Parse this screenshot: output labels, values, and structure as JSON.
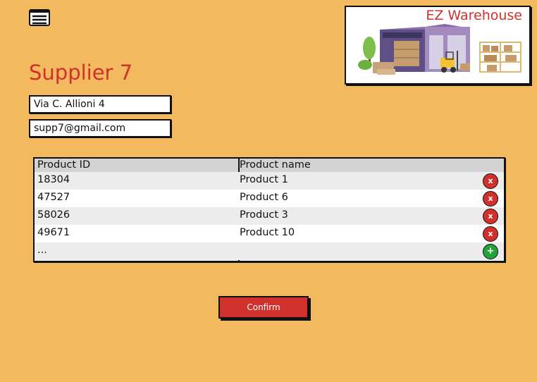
{
  "header": {
    "menu_icon": "hamburger-menu-icon",
    "brand_title": "EZ Warehouse"
  },
  "supplier": {
    "title": "Supplier 7",
    "address": "Via C. Allioni 4",
    "email": "supp7@gmail.com"
  },
  "table": {
    "columns": [
      "Product ID",
      "Product name"
    ],
    "rows": [
      {
        "id": "18304",
        "name": "Product 1",
        "action": "x"
      },
      {
        "id": "47527",
        "name": "Product 6",
        "action": "x"
      },
      {
        "id": "58026",
        "name": "Product 3",
        "action": "x"
      },
      {
        "id": "49671",
        "name": "Product 10",
        "action": "x"
      }
    ],
    "more_row": {
      "id": "...",
      "action": "+"
    }
  },
  "actions": {
    "confirm_label": "Confirm"
  },
  "colors": {
    "background": "#f2b95f",
    "accent_red": "#d0312d",
    "add_green": "#21a33a"
  }
}
